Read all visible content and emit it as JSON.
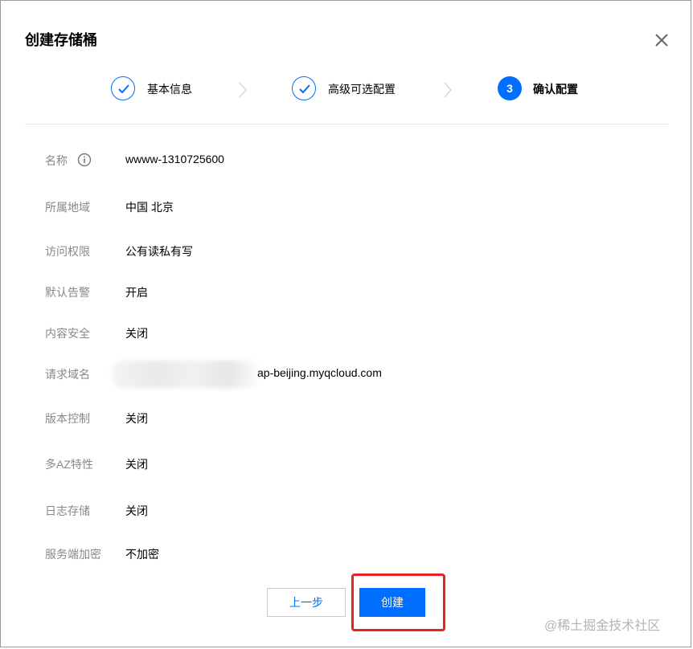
{
  "dialog": {
    "title": "创建存储桶"
  },
  "steps": [
    {
      "label": "基本信息",
      "status": "done"
    },
    {
      "label": "高级可选配置",
      "status": "done"
    },
    {
      "label": "确认配置",
      "status": "active",
      "number": "3"
    }
  ],
  "rows": [
    {
      "label": "名称",
      "value": "wwww-1310725600"
    },
    {
      "label": "所属地域",
      "value": "中国 北京"
    },
    {
      "label": "访问权限",
      "value": "公有读私有写"
    },
    {
      "label": "默认告警",
      "value": "开启"
    },
    {
      "label": "内容安全",
      "value": "关闭"
    },
    {
      "label": "请求域名",
      "value": "ap-beijing.myqcloud.com"
    },
    {
      "label": "版本控制",
      "value": "关闭"
    },
    {
      "label": "多AZ特性",
      "value": "关闭"
    },
    {
      "label": "日志存储",
      "value": "关闭"
    },
    {
      "label": "服务端加密",
      "value": "不加密"
    }
  ],
  "buttons": {
    "prev": "上一步",
    "create": "创建"
  },
  "watermark": "@稀土掘金技术社区",
  "colors": {
    "primary": "#006eff",
    "highlight": "#e8231f",
    "label": "#888888"
  },
  "icons": {
    "close": "close-icon",
    "check": "check-icon",
    "step_separator": "chevron-right-icon",
    "info": "info-icon"
  }
}
